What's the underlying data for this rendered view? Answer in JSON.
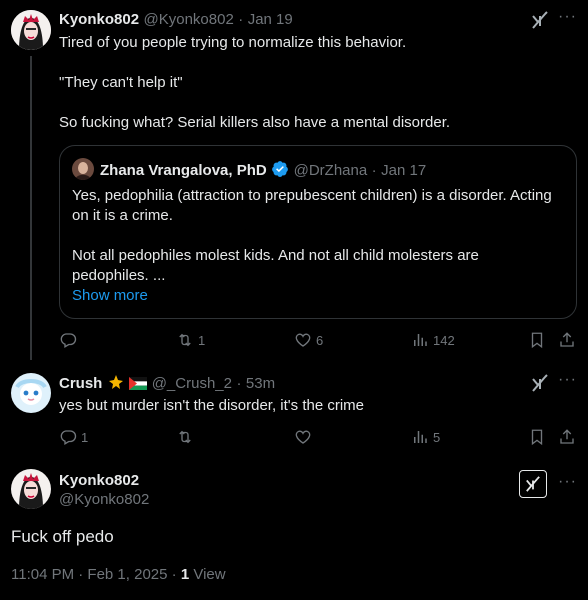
{
  "tweet1": {
    "author_name": "Kyonko802",
    "handle": "@Kyonko802",
    "date": "Jan 19",
    "lines": [
      "Tired of you people trying to normalize this behavior.",
      "\"They can't help it\"",
      "So fucking what? Serial killers also have a mental disorder."
    ],
    "quote": {
      "author_name": "Zhana Vrangalova, PhD",
      "handle": "@DrZhana",
      "date": "Jan 17",
      "para1": "Yes, pedophilia (attraction to prepubescent children) is a disorder. Acting on it is a crime.",
      "para2": "Not all pedophiles molest kids. And not all child molesters are pedophiles. ...",
      "show_more": "Show more"
    },
    "actions": {
      "replies": "",
      "reposts": "1",
      "likes": "6",
      "views": "142"
    }
  },
  "tweet2": {
    "author_name": "Crush",
    "handle": "@_Crush_2",
    "date": "53m",
    "text": "yes but murder isn't the disorder, it's the crime",
    "actions": {
      "replies": "1",
      "reposts": "",
      "likes": "",
      "views": "5"
    }
  },
  "tweet3": {
    "author_name": "Kyonko802",
    "handle": "@Kyonko802",
    "text": "Fuck off pedo",
    "timestamp": "11:04 PM · Feb 1, 2025 ·",
    "view_count": "1",
    "view_label": "View"
  },
  "icons": {
    "grok": "grok-icon",
    "more": "more-icon",
    "reply": "reply-icon",
    "repost": "repost-icon",
    "like": "heart-icon",
    "views": "views-icon",
    "bookmark": "bookmark-icon",
    "share": "share-icon"
  },
  "colors": {
    "background": "#000000",
    "text": "#e7e9ea",
    "muted": "#71767b",
    "link": "#1d9bf0",
    "verified": "#1d9bf0"
  }
}
